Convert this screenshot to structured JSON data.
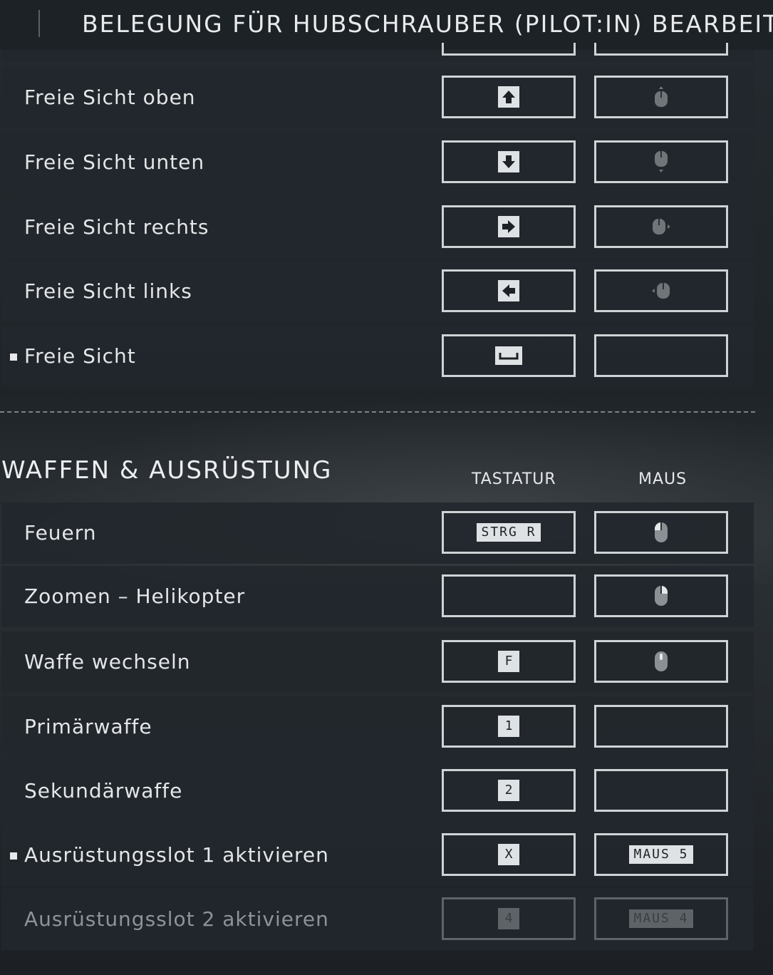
{
  "header": {
    "title": "BELEGUNG FÜR HUBSCHRAUBER (PILOT:IN) BEARBEITE"
  },
  "view_rows": [
    {
      "label": "Freie Sicht oben",
      "keyboard_icon": "arrow-up-key-icon",
      "mouse_icon": "mouse-up-icon",
      "bullet": false
    },
    {
      "label": "Freie Sicht unten",
      "keyboard_icon": "arrow-down-key-icon",
      "mouse_icon": "mouse-down-icon",
      "bullet": false
    },
    {
      "label": "Freie Sicht rechts",
      "keyboard_icon": "arrow-right-key-icon",
      "mouse_icon": "mouse-right-icon",
      "bullet": false
    },
    {
      "label": "Freie Sicht links",
      "keyboard_icon": "arrow-left-key-icon",
      "mouse_icon": "mouse-left-icon",
      "bullet": false
    },
    {
      "label": "Freie Sicht",
      "keyboard_icon": "spacebar-key-icon",
      "mouse_icon": "",
      "bullet": true
    }
  ],
  "section": {
    "title": "WAFFEN & AUSRÜSTUNG",
    "col_keyboard": "TASTATUR",
    "col_mouse": "MAUS"
  },
  "weapon_rows": [
    {
      "label": "Feuern",
      "keyboard": "STRG R",
      "mouse_icon": "mouse-left-button-icon"
    },
    {
      "label": "Zoomen – Helikopter",
      "keyboard": "",
      "mouse_icon": "mouse-right-button-icon"
    },
    {
      "label": "Waffe wechseln",
      "keyboard": "F",
      "mouse_icon": "mouse-wheel-icon"
    },
    {
      "label": "Primärwaffe",
      "keyboard": "1",
      "mouse": ""
    },
    {
      "label": "Sekundärwaffe",
      "keyboard": "2",
      "mouse": ""
    },
    {
      "label": "Ausrüstungsslot 1 aktivieren",
      "keyboard": "X",
      "mouse": "MAUS 5",
      "bullet": true
    },
    {
      "label": "Ausrüstungsslot 2 aktivieren",
      "keyboard": "4",
      "mouse": "MAUS 4",
      "disabled": true
    }
  ]
}
